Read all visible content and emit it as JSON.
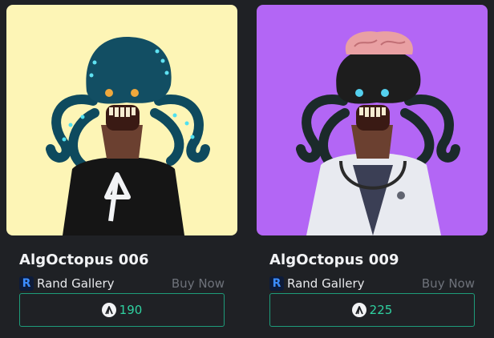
{
  "cards": [
    {
      "title": "AlgOctopus 006",
      "gallery": "Rand Gallery",
      "buy_label": "Buy Now",
      "price": "190",
      "bg_color": "#fdf5b6"
    },
    {
      "title": "AlgOctopus 009",
      "gallery": "Rand Gallery",
      "buy_label": "Buy Now",
      "price": "225",
      "bg_color": "#b366f5"
    }
  ],
  "gallery_logo_letter": "R",
  "accent_color": "#2fd1a0",
  "border_color": "#1e9c7a"
}
